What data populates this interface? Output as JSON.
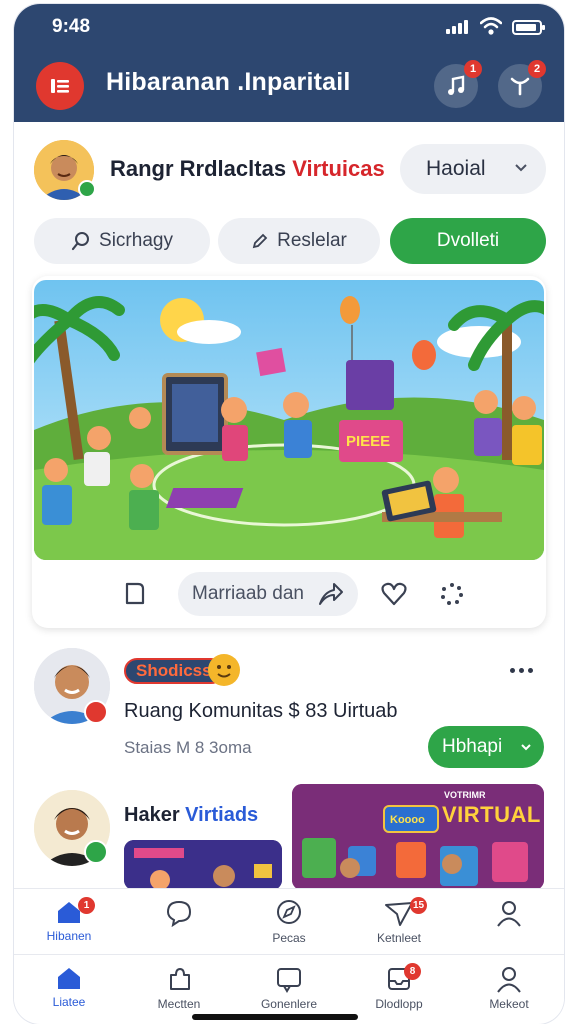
{
  "status_bar": {
    "time": "9:48"
  },
  "header": {
    "title": "Hibaranan .Inparitail",
    "music_badge": "1",
    "notif_badge": "2",
    "colors": {
      "bar": "#2d4770",
      "accent": "#e0382f"
    }
  },
  "profile": {
    "name_main": "Rangr Rrdlacltas",
    "name_accent": "Virtuicas",
    "select_value": "Haoial"
  },
  "chips": [
    {
      "label": "Sicrhagy",
      "icon": "search-icon"
    },
    {
      "label": "Reslelar",
      "icon": "pencil-icon"
    },
    {
      "label": "Dvolleti",
      "icon": ""
    }
  ],
  "feed_card": {
    "comment_placeholder": "Marriaab dan",
    "hero_sign": "PIEEE"
  },
  "post": {
    "badge": "Shodicss",
    "title": "Ruang Komunitas  $ 83 Uirtuab",
    "subtitle": "Staias M 8 3oma",
    "join_label": "Hbhapi"
  },
  "post2": {
    "title_main": "Haker",
    "title_accent": "Virtiads",
    "banner_small": "VOTRIMR",
    "banner_title": "VIRTUAL",
    "banner_sign": "Koooo"
  },
  "nav_top": [
    {
      "label": "Hibanen",
      "icon": "home-icon",
      "badge": "1",
      "active": true
    },
    {
      "label": "",
      "icon": "chat-bubble-icon",
      "badge": "",
      "active": false
    },
    {
      "label": "Pecas",
      "icon": "compass-icon",
      "badge": "",
      "active": false
    },
    {
      "label": "Ketnleet",
      "icon": "send-icon",
      "badge": "15",
      "active": false
    },
    {
      "label": "",
      "icon": "person-icon",
      "badge": "",
      "active": false
    }
  ],
  "nav_bottom": [
    {
      "label": "Liatee",
      "icon": "home-icon",
      "badge": "",
      "active": true
    },
    {
      "label": "Mectten",
      "icon": "puzzle-icon",
      "badge": "",
      "active": false
    },
    {
      "label": "Gonenlere",
      "icon": "message-icon",
      "badge": "",
      "active": false
    },
    {
      "label": "Dlodlopp",
      "icon": "inbox-icon",
      "badge": "8",
      "active": false
    },
    {
      "label": "Mekeot",
      "icon": "person-icon",
      "badge": "",
      "active": false
    }
  ]
}
